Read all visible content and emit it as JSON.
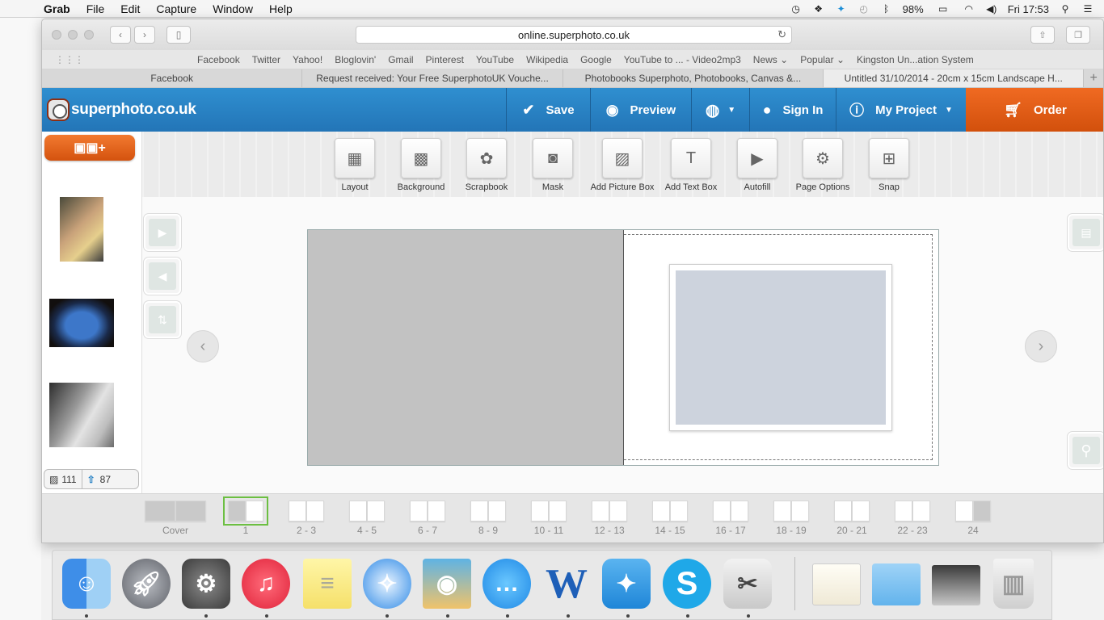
{
  "menubar": {
    "app_name": "Grab",
    "menus": [
      "File",
      "Edit",
      "Capture",
      "Window",
      "Help"
    ],
    "battery": "98%",
    "clock": "Fri 17:53"
  },
  "browser": {
    "url": "online.superphoto.co.uk",
    "favorites": [
      "Facebook",
      "Twitter",
      "Yahoo!",
      "Bloglovin'",
      "Gmail",
      "Pinterest",
      "YouTube",
      "Wikipedia",
      "Google",
      "YouTube to ... - Video2mp3",
      "News",
      "Popular",
      "Kingston Un...ation System"
    ],
    "tabs": [
      {
        "label": "Facebook"
      },
      {
        "label": "Request received: Your Free SuperphotoUK Vouche..."
      },
      {
        "label": "Photobooks Superphoto, Photobooks, Canvas &..."
      },
      {
        "label": "Untitled 31/10/2014 - 20cm x 15cm Landscape H..."
      }
    ]
  },
  "site": {
    "logo_text": "superphoto.co.uk",
    "header": {
      "save": "Save",
      "preview": "Preview",
      "sign_in": "Sign In",
      "my_project": "My Project",
      "order": "Order"
    },
    "tools": [
      "Layout",
      "Background",
      "Scrapbook",
      "Mask",
      "Add Picture Box",
      "Add Text Box",
      "Autofill",
      "Page Options",
      "Snap"
    ],
    "photo_count": "111",
    "upload_count": "87",
    "pages": [
      "Cover",
      "1",
      "2 - 3",
      "4 - 5",
      "6 - 7",
      "8 - 9",
      "10 - 11",
      "12 - 13",
      "14 - 15",
      "16 - 17",
      "18 - 19",
      "20 - 21",
      "22 - 23",
      "24"
    ],
    "selected_page": "1"
  },
  "colors": {
    "header_blue": "#2a83c5",
    "order_orange": "#e45e17",
    "selected_green": "#6cbf42"
  }
}
